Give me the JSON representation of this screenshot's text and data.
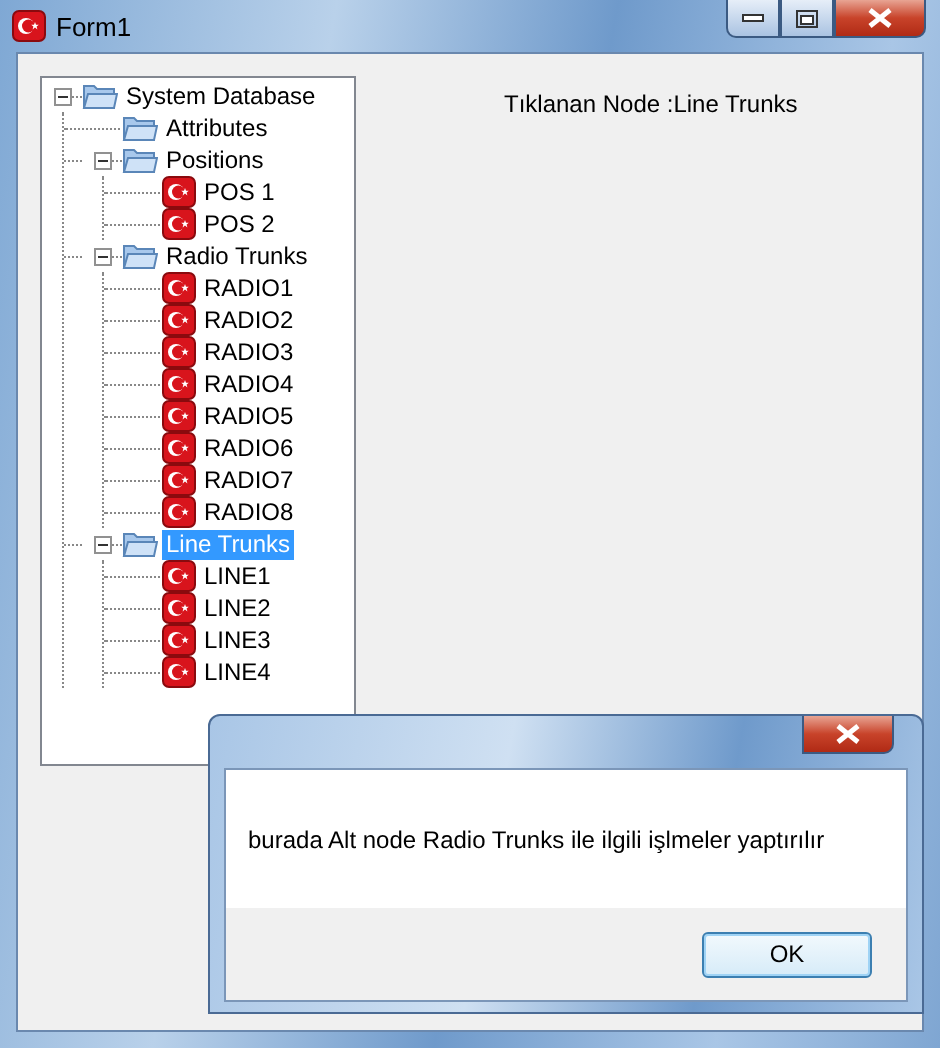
{
  "window": {
    "title": "Form1"
  },
  "tree": [
    {
      "label": "System Database",
      "kind": "folder",
      "expanded": true,
      "selected": false,
      "children": [
        {
          "label": "Attributes",
          "kind": "folder",
          "selected": false
        },
        {
          "label": "Positions",
          "kind": "folder",
          "expanded": true,
          "selected": false,
          "children": [
            {
              "label": "POS 1",
              "kind": "flag",
              "selected": false
            },
            {
              "label": "POS 2",
              "kind": "flag",
              "selected": false
            }
          ]
        },
        {
          "label": "Radio Trunks",
          "kind": "folder",
          "expanded": true,
          "selected": false,
          "children": [
            {
              "label": "RADIO1",
              "kind": "flag",
              "selected": false
            },
            {
              "label": "RADIO2",
              "kind": "flag",
              "selected": false
            },
            {
              "label": "RADIO3",
              "kind": "flag",
              "selected": false
            },
            {
              "label": "RADIO4",
              "kind": "flag",
              "selected": false
            },
            {
              "label": "RADIO5",
              "kind": "flag",
              "selected": false
            },
            {
              "label": "RADIO6",
              "kind": "flag",
              "selected": false
            },
            {
              "label": "RADIO7",
              "kind": "flag",
              "selected": false
            },
            {
              "label": "RADIO8",
              "kind": "flag",
              "selected": false
            }
          ]
        },
        {
          "label": "Line Trunks",
          "kind": "folder",
          "expanded": true,
          "selected": true,
          "children": [
            {
              "label": "LINE1",
              "kind": "flag",
              "selected": false
            },
            {
              "label": "LINE2",
              "kind": "flag",
              "selected": false
            },
            {
              "label": "LINE3",
              "kind": "flag",
              "selected": false
            },
            {
              "label": "LINE4",
              "kind": "flag",
              "selected": false
            }
          ]
        }
      ]
    }
  ],
  "clicked_label": "Tıklanan Node :Line Trunks",
  "dialog": {
    "message": "burada Alt node Radio Trunks ile ilgili işlmeler yaptırılır",
    "buttons": [
      "OK"
    ]
  }
}
